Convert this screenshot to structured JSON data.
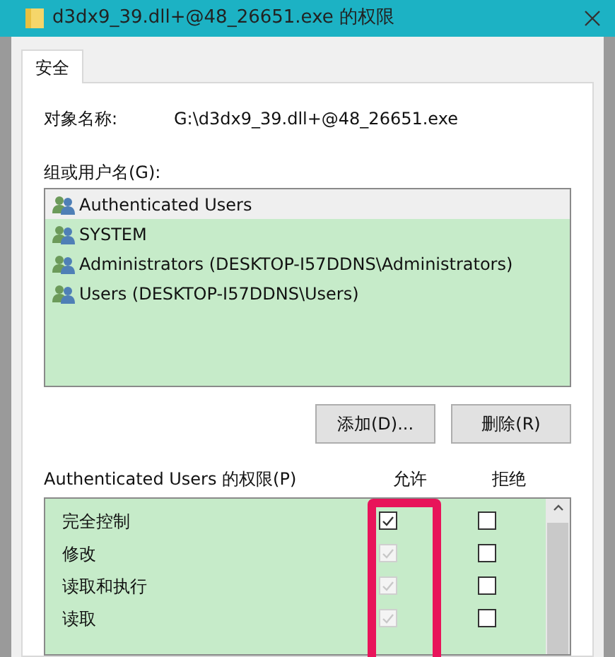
{
  "window": {
    "title": "d3dx9_39.dll+@48_26651.exe 的权限"
  },
  "tabs": [
    {
      "label": "安全",
      "selected": true
    }
  ],
  "object": {
    "label": "对象名称:",
    "value": "G:\\d3dx9_39.dll+@48_26651.exe"
  },
  "groups": {
    "label": "组或用户名(G):",
    "items": [
      {
        "name": "Authenticated Users",
        "selected": true
      },
      {
        "name": "SYSTEM",
        "selected": false
      },
      {
        "name": "Administrators (DESKTOP-I57DDNS\\Administrators)",
        "selected": false
      },
      {
        "name": "Users (DESKTOP-I57DDNS\\Users)",
        "selected": false
      }
    ]
  },
  "buttons": [
    "添加(D)...",
    "删除(R)"
  ],
  "permissions": {
    "label": "Authenticated Users 的权限(P)",
    "allow_header": "允许",
    "deny_header": "拒绝",
    "rows": [
      {
        "name": "完全控制",
        "allow": {
          "checked": true,
          "disabled": false
        },
        "deny": {
          "checked": false,
          "disabled": false
        }
      },
      {
        "name": "修改",
        "allow": {
          "checked": true,
          "disabled": true
        },
        "deny": {
          "checked": false,
          "disabled": false
        }
      },
      {
        "name": "读取和执行",
        "allow": {
          "checked": true,
          "disabled": true
        },
        "deny": {
          "checked": false,
          "disabled": false
        }
      },
      {
        "name": "读取",
        "allow": {
          "checked": true,
          "disabled": true
        },
        "deny": {
          "checked": false,
          "disabled": false
        }
      }
    ]
  }
}
